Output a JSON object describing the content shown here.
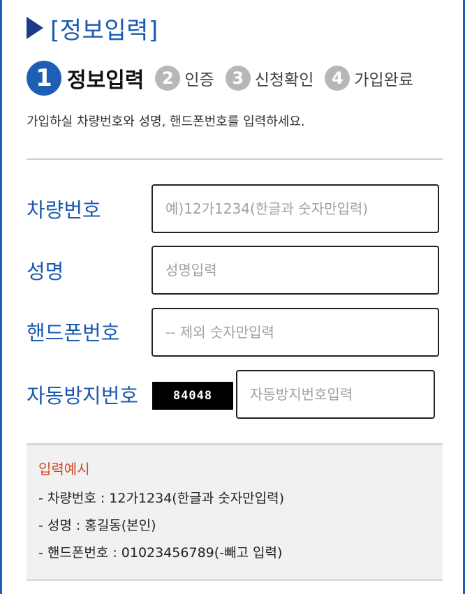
{
  "header": {
    "title": "[정보입력]",
    "arrow_color": "#1a3a8a"
  },
  "steps": [
    {
      "num": "1",
      "label": "정보입력",
      "active": true
    },
    {
      "num": "2",
      "label": "인증",
      "active": false
    },
    {
      "num": "3",
      "label": "신청확인",
      "active": false
    },
    {
      "num": "4",
      "label": "가입완료",
      "active": false
    }
  ],
  "description": "가입하실 차량번호와 성명, 핸드폰번호를 입력하세요.",
  "form": {
    "vehicle": {
      "label": "차량번호",
      "placeholder": "예)12가1234(한글과 숫자만입력)",
      "value": ""
    },
    "name": {
      "label": "성명",
      "placeholder": "성명입력",
      "value": ""
    },
    "phone": {
      "label": "핸드폰번호",
      "placeholder": "-- 제외 숫자만입력",
      "value": ""
    },
    "captcha": {
      "label": "자동방지번호",
      "code": "84048",
      "placeholder": "자동방지번호입력",
      "value": ""
    }
  },
  "example": {
    "title": "입력예시",
    "items": [
      "- 차량번호 : 12가1234(한글과 숫자만입력)",
      "- 성명 : 홍길동(본인)",
      "- 핸드폰번호 : 01023456789(-빼고 입력)"
    ]
  },
  "colors": {
    "accent": "#1e5fb4",
    "label_blue": "#1b5ab0",
    "example_title": "#d24a2a",
    "inactive_step": "#b7b7b7"
  }
}
